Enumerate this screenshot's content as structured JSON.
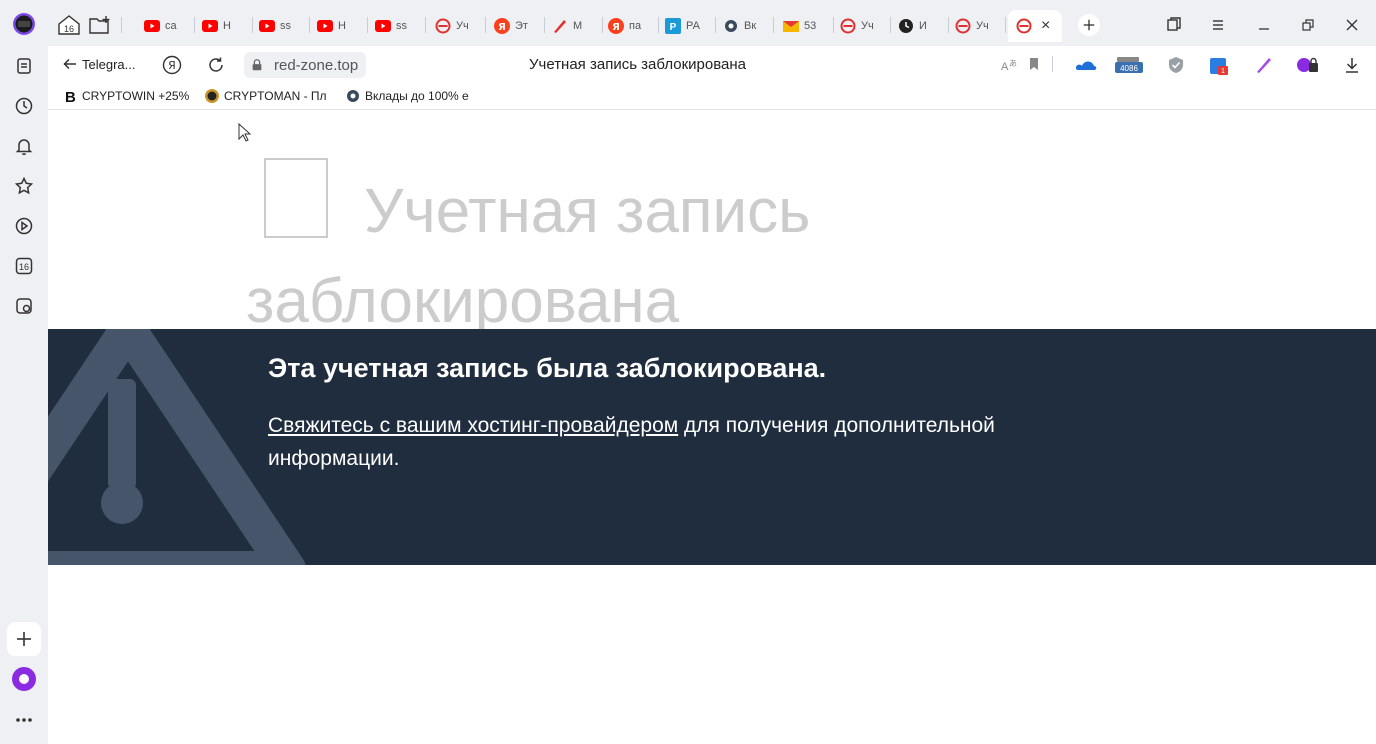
{
  "tabs": {
    "items": [
      {
        "icon": "youtube-icon",
        "label": "ca",
        "color": "#ff0000"
      },
      {
        "icon": "youtube-icon",
        "label": "H",
        "color": "#ff0000"
      },
      {
        "icon": "youtube-icon",
        "label": "ss",
        "color": "#ff0000"
      },
      {
        "icon": "youtube-icon",
        "label": "H",
        "color": "#ff0000"
      },
      {
        "icon": "youtube-icon",
        "label": "ss",
        "color": "#ff0000"
      },
      {
        "icon": "blocked-site-icon",
        "label": "Уч",
        "color": "#e03030"
      },
      {
        "icon": "yandex-icon",
        "label": "Эт",
        "color": "#fc3f1d"
      },
      {
        "icon": "pen-icon",
        "label": "М",
        "color": "#e03030"
      },
      {
        "icon": "yandex-icon",
        "label": "па",
        "color": "#fc3f1d"
      },
      {
        "icon": "p-icon",
        "label": "РА",
        "color": "#1a9ad9"
      },
      {
        "icon": "gear-icon",
        "label": "Вк",
        "color": "#3a4a5c"
      },
      {
        "icon": "mail-icon",
        "label": "53",
        "color": "#f5b700"
      },
      {
        "icon": "blocked-site-icon",
        "label": "Уч",
        "color": "#e03030"
      },
      {
        "icon": "clock-icon",
        "label": "И",
        "color": "#222222"
      },
      {
        "icon": "blocked-site-icon",
        "label": "Уч",
        "color": "#e03030"
      }
    ],
    "home_counter": "16"
  },
  "address": {
    "back_label": "Telegra...",
    "domain": "red-zone.top",
    "page_title": "Учетная запись заблокирована",
    "extension_badge": "4086"
  },
  "bookmarks": [
    {
      "icon": "b-letter-icon",
      "label": "CRYPTOWIN +25%"
    },
    {
      "icon": "coin-icon",
      "label": "CRYPTOMAN - Пл"
    },
    {
      "icon": "gear-icon",
      "label": "Вклады до 100% е"
    }
  ],
  "sidebar": {
    "counter": "16"
  },
  "page": {
    "heading": "Учетная запись заблокирована",
    "banner_title": "Эта учетная запись была заблокирована.",
    "banner_link": "Свяжитесь с вашим хостинг-провайдером",
    "banner_text": " для получения дополнительной информации."
  },
  "colors": {
    "banner_bg": "#1f2d3f",
    "heading_gray": "#cccccc",
    "chrome_bg": "#eef0f4"
  }
}
